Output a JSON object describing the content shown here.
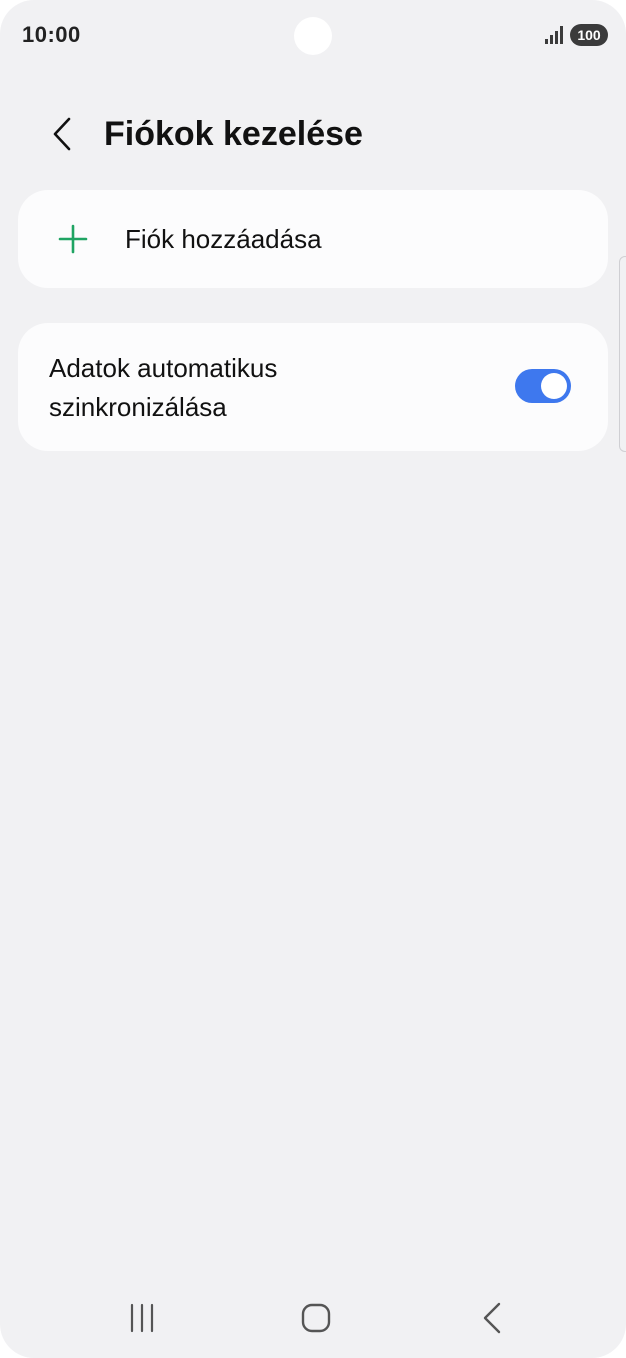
{
  "status_bar": {
    "time": "10:00",
    "battery": "100"
  },
  "header": {
    "title": "Fiókok kezelése"
  },
  "settings": {
    "add_account_label": "Fiók hozzáadása",
    "auto_sync_label": "Adatok automatikus szinkronizálása",
    "auto_sync_enabled": true
  },
  "colors": {
    "background": "#f1f1f3",
    "card": "#fcfcfd",
    "accent_green": "#1fa463",
    "toggle_on": "#3e78ee"
  },
  "icons": {
    "back": "back-arrow-icon",
    "add": "plus-icon",
    "recents": "recent-apps-icon",
    "home": "home-icon",
    "nav_back": "back-icon"
  }
}
